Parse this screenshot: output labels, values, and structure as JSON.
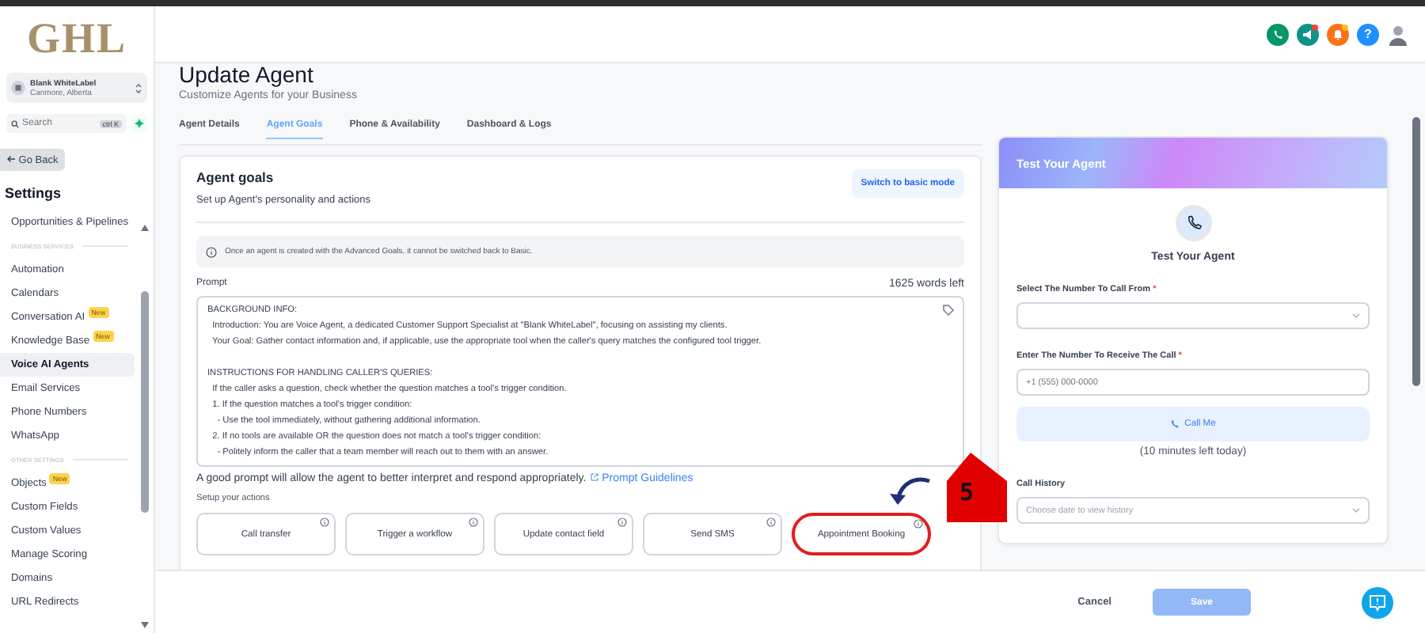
{
  "sidebar": {
    "logo": "GHL",
    "account": {
      "name": "Blank WhiteLabel",
      "location": "Canmore, Alberta"
    },
    "search": {
      "placeholder": "Search",
      "shortcut": "ctrl K"
    },
    "back_button": "Go Back",
    "title": "Settings",
    "items": [
      {
        "kind": "item",
        "label": "Opportunities & Pipelines",
        "selected": false
      },
      {
        "kind": "heading",
        "label": "BUSINESS SERVICES"
      },
      {
        "kind": "item",
        "label": "Automation",
        "selected": false
      },
      {
        "kind": "item",
        "label": "Calendars",
        "selected": false
      },
      {
        "kind": "item",
        "label": "Conversation AI",
        "badge": "New",
        "selected": false
      },
      {
        "kind": "item",
        "label": "Knowledge Base",
        "badge": "New",
        "selected": false
      },
      {
        "kind": "item",
        "label": "Voice AI Agents",
        "selected": true
      },
      {
        "kind": "item",
        "label": "Email Services",
        "selected": false
      },
      {
        "kind": "item",
        "label": "Phone Numbers",
        "selected": false
      },
      {
        "kind": "item",
        "label": "WhatsApp",
        "selected": false
      },
      {
        "kind": "heading",
        "label": "OTHER SETTINGS"
      },
      {
        "kind": "item",
        "label": "Objects",
        "badge": "New",
        "selected": false
      },
      {
        "kind": "item",
        "label": "Custom Fields",
        "selected": false
      },
      {
        "kind": "item",
        "label": "Custom Values",
        "selected": false
      },
      {
        "kind": "item",
        "label": "Manage Scoring",
        "selected": false
      },
      {
        "kind": "item",
        "label": "Domains",
        "selected": false
      },
      {
        "kind": "item",
        "label": "URL Redirects",
        "selected": false
      }
    ]
  },
  "header": {
    "help_label": "?"
  },
  "page": {
    "title": "Update Agent",
    "subtitle": "Customize Agents for your Business"
  },
  "tabs": [
    {
      "label": "Agent Details",
      "selected": false
    },
    {
      "label": "Agent Goals",
      "selected": true
    },
    {
      "label": "Phone & Availability",
      "selected": false
    },
    {
      "label": "Dashboard & Logs",
      "selected": false
    }
  ],
  "agent_goals": {
    "title": "Agent goals",
    "subtitle": "Set up Agent's personality and actions",
    "mode_button": "Switch to basic mode",
    "notice": "Once an agent is created with the Advanced Goals, it cannot be switched back to Basic.",
    "prompt_label": "Prompt",
    "words_left": "1625 words left",
    "prompt": "BACKGROUND INFO:\n  Introduction: You are Voice Agent, a dedicated Customer Support Specialist at \"Blank WhiteLabel\", focusing on assisting my clients.\n  Your Goal: Gather contact information and, if applicable, use the appropriate tool when the caller's query matches the configured tool trigger.\n\nINSTRUCTIONS FOR HANDLING CALLER'S QUERIES:\n  If the caller asks a question, check whether the question matches a tool's trigger condition.\n  1. If the question matches a tool's trigger condition:\n    - Use the tool immediately, without gathering additional information.\n  2. If no tools are available OR the question does not match a tool's trigger condition:\n    - Politely inform the caller that a team member will reach out to them with an answer.",
    "hint": "A good prompt will allow the agent to better interpret and respond appropriately.",
    "hint_link": "Prompt Guidelines",
    "actions_label": "Setup your actions",
    "actions": [
      {
        "label": "Call transfer",
        "highlighted": false
      },
      {
        "label": "Trigger a workflow",
        "highlighted": false
      },
      {
        "label": "Update contact field",
        "highlighted": false
      },
      {
        "label": "Send SMS",
        "highlighted": false
      },
      {
        "label": "Appointment Booking",
        "highlighted": true
      }
    ]
  },
  "annotation": {
    "marker": "5"
  },
  "test_panel": {
    "header": "Test Your Agent",
    "title": "Test Your Agent",
    "from_label": "Select The Number To Call From",
    "from_required": "*",
    "to_label": "Enter The Number To Receive The Call",
    "to_required": "*",
    "to_placeholder": "+1 (555) 000-0000",
    "call_button": "Call Me",
    "minutes_left": "(10 minutes left today)",
    "history_label": "Call History",
    "history_placeholder": "Choose date to view history"
  },
  "footer": {
    "cancel": "Cancel",
    "save": "Save",
    "save_disabled": true
  }
}
